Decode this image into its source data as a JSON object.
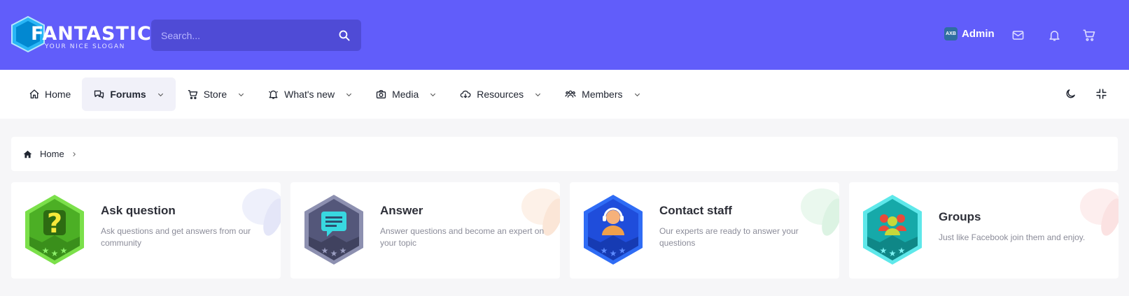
{
  "header": {
    "logo_text": "FANTASTIC",
    "logo_slogan": "YOUR NICE SLOGAN",
    "search_placeholder": "Search...",
    "user": {
      "name": "Admin",
      "avatar_text": "AXB"
    },
    "icons": [
      "mail-icon",
      "bell-icon",
      "cart-icon"
    ]
  },
  "nav": {
    "items": [
      {
        "label": "Home",
        "icon": "home-icon",
        "has_dropdown": false,
        "active": false
      },
      {
        "label": "Forums",
        "icon": "chat-icon",
        "has_dropdown": true,
        "active": true
      },
      {
        "label": "Store",
        "icon": "cart-icon",
        "has_dropdown": true,
        "active": false
      },
      {
        "label": "What's new",
        "icon": "bell-icon",
        "has_dropdown": true,
        "active": false
      },
      {
        "label": "Media",
        "icon": "camera-icon",
        "has_dropdown": true,
        "active": false
      },
      {
        "label": "Resources",
        "icon": "cloud-download-icon",
        "has_dropdown": true,
        "active": false
      },
      {
        "label": "Members",
        "icon": "users-icon",
        "has_dropdown": true,
        "active": false
      }
    ],
    "right_icons": [
      "moon-icon",
      "collapse-icon"
    ]
  },
  "breadcrumb": {
    "home_label": "Home"
  },
  "cards": [
    {
      "title": "Ask question",
      "desc": "Ask questions and get answers from our community",
      "color": "#4caf25"
    },
    {
      "title": "Answer",
      "desc": "Answer questions and become an expert on your topic",
      "color": "#54577a"
    },
    {
      "title": "Contact staff",
      "desc": "Our experts are ready to answer your questions",
      "color": "#1f4ddb"
    },
    {
      "title": "Groups",
      "desc": "Just like Facebook join them and enjoy.",
      "color": "#16a9a9"
    }
  ],
  "colors": {
    "brand": "#615dfa",
    "search_bg": "#4f4bd6",
    "page_bg": "#f6f6f8"
  }
}
